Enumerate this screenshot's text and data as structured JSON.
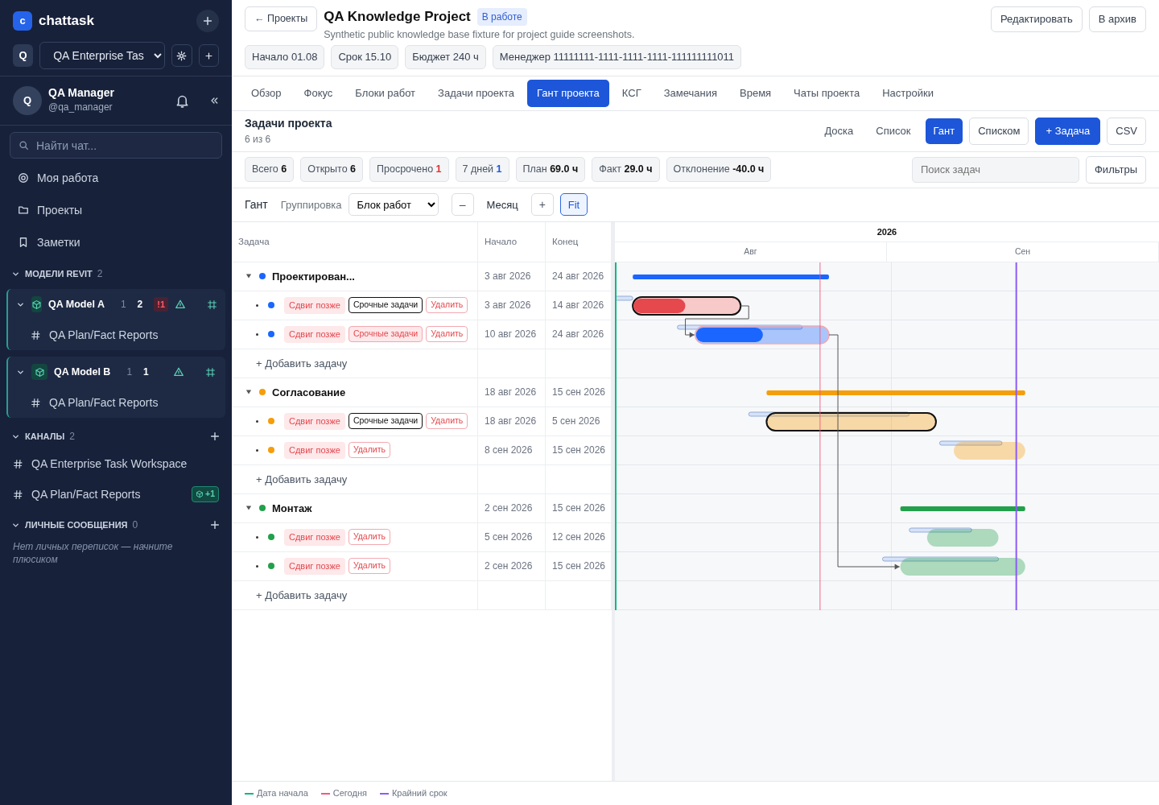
{
  "sidebar": {
    "logo": "c",
    "app_name": "chattask",
    "workspace_avatar": "Q",
    "workspace": "QA Enterprise Tas",
    "user": {
      "avatar": "Q",
      "name": "QA Manager",
      "handle": "@qa_manager"
    },
    "search": {
      "placeholder": "Найти чат..."
    },
    "nav": [
      {
        "label": "Моя работа",
        "kind": "target"
      },
      {
        "label": "Проекты",
        "kind": "folder"
      },
      {
        "label": "Заметки",
        "kind": "bookmark"
      }
    ],
    "models_section": {
      "title": "МОДЕЛИ REVIT",
      "count": "2",
      "expanded": true,
      "models": [
        {
          "name": "QA Model A",
          "expanded": true,
          "counts": [
            "1",
            "2"
          ],
          "alert": "!1",
          "channels": [
            "QA Plan/Fact Reports"
          ]
        },
        {
          "name": "QA Model B",
          "expanded": true,
          "counts": [
            "1",
            "1"
          ],
          "channels": [
            "QA Plan/Fact Reports"
          ]
        }
      ]
    },
    "channels_section": {
      "title": "КАНАЛЫ",
      "count": "2",
      "expanded": true,
      "channels": [
        {
          "name": "QA Enterprise Task Workspace"
        },
        {
          "name": "QA Plan/Fact Reports",
          "badge": "+1"
        }
      ]
    },
    "dm_section": {
      "title": "ЛИЧНЫЕ СООБЩЕНИЯ",
      "count": "0",
      "expanded": true,
      "empty_text": "Нет личных переписок — начните плюсиком"
    }
  },
  "header": {
    "back": "← Проекты",
    "title": "QA Knowledge Project",
    "status": "В работе",
    "description": "Synthetic public knowledge base fixture for project guide screenshots.",
    "chips": [
      "Начало 01.08",
      "Срок 15.10",
      "Бюджет 240 ч",
      "Менеджер 11111111-1111-1111-1111-111111111011"
    ],
    "actions": [
      "Редактировать",
      "В архив"
    ]
  },
  "tabs": [
    {
      "label": "Обзор",
      "selected": false
    },
    {
      "label": "Фокус",
      "selected": false
    },
    {
      "label": "Блоки работ",
      "selected": false
    },
    {
      "label": "Задачи проекта",
      "selected": false
    },
    {
      "label": "Гант проекта",
      "selected": true
    },
    {
      "label": "КСГ",
      "selected": false
    },
    {
      "label": "Замечания",
      "selected": false
    },
    {
      "label": "Время",
      "selected": false
    },
    {
      "label": "Чаты проекта",
      "selected": false
    },
    {
      "label": "Настройки",
      "selected": false
    }
  ],
  "tasks": {
    "title": "Задачи проекта",
    "count": "6 из 6",
    "views": [
      {
        "label": "Доска",
        "selected": false
      },
      {
        "label": "Список",
        "selected": false
      },
      {
        "label": "Гант",
        "selected": true
      }
    ],
    "buttons": [
      {
        "label": "Списком",
        "kind": "outline"
      },
      {
        "label": "+ Задача",
        "kind": "primary"
      },
      {
        "label": "CSV",
        "kind": "outline"
      }
    ],
    "stats": [
      {
        "label": "Всего",
        "value": "6",
        "kind": "plain"
      },
      {
        "label": "Открыто",
        "value": "6",
        "kind": "plain"
      },
      {
        "label": "Просрочено",
        "value": "1",
        "kind": "danger"
      },
      {
        "label": "7 дней",
        "value": "1",
        "kind": "primary"
      },
      {
        "label": "План",
        "value": "69.0 ч",
        "kind": "plain"
      },
      {
        "label": "Факт",
        "value": "29.0 ч",
        "kind": "plain"
      },
      {
        "label": "Отклонение",
        "value": "-40.0 ч",
        "kind": "plain"
      }
    ],
    "search": {
      "placeholder": "Поиск задач"
    },
    "filters": "Фильтры"
  },
  "gantt": {
    "label": "Гант",
    "grouping_label": "Группировка",
    "grouping": "Блок работ",
    "zoom_out": "–",
    "scale": "Месяц",
    "zoom_in": "+",
    "fit": {
      "label": "Fit",
      "selected": true
    },
    "columns": [
      "Задача",
      "Начало",
      "Конец"
    ],
    "year": "2026",
    "months": [
      "Авг",
      "Сен"
    ],
    "groups": [
      {
        "name": "Проектирован...",
        "color": "#1a66ff",
        "start": "3 авг 2026",
        "end": "24 авг 2026",
        "expanded": true,
        "add": "+ Добавить задачу",
        "tasks": [
          {
            "tag": "Сдвиг позже",
            "start": "3 авг 2026",
            "end": "14 авг 2026",
            "overdue": true,
            "level": 0.48,
            "actions": [
              {
                "label": "Срочные задачи",
                "kind": "urgent",
                "selected": true
              },
              {
                "label": "Удалить",
                "kind": "delete"
              }
            ]
          },
          {
            "tag": "Сдвиг позже",
            "start": "10 авг 2026",
            "end": "24 авг 2026",
            "overdue": false,
            "level": 0.5,
            "actions": [
              {
                "label": "Срочные задачи",
                "kind": "urgent",
                "selected": false
              },
              {
                "label": "Удалить",
                "kind": "delete"
              }
            ]
          }
        ]
      },
      {
        "name": "Согласование",
        "color": "#f59e0b",
        "start": "18 авг 2026",
        "end": "15 сен 2026",
        "expanded": true,
        "add": "+ Добавить задачу",
        "tasks": [
          {
            "tag": "Сдвиг позже",
            "start": "18 авг 2026",
            "end": "5 сен 2026",
            "overdue": false,
            "actions": [
              {
                "label": "Срочные задачи",
                "kind": "urgent",
                "selected": true
              },
              {
                "label": "Удалить",
                "kind": "delete"
              }
            ]
          },
          {
            "tag": "Сдвиг позже",
            "start": "8 сен 2026",
            "end": "15 сен 2026",
            "overdue": false,
            "actions": [
              {
                "label": "Удалить",
                "kind": "delete"
              }
            ]
          }
        ]
      },
      {
        "name": "Монтаж",
        "color": "#22a04b",
        "start": "2 сен 2026",
        "end": "15 сен 2026",
        "expanded": true,
        "add": "+ Добавить задачу",
        "tasks": [
          {
            "tag": "Сдвиг позже",
            "start": "5 сен 2026",
            "end": "12 сен 2026",
            "overdue": false,
            "actions": [
              {
                "label": "Удалить",
                "kind": "delete"
              }
            ]
          },
          {
            "tag": "Сдвиг позже",
            "start": "2 сен 2026",
            "end": "15 сен 2026",
            "overdue": false,
            "actions": [
              {
                "label": "Удалить",
                "kind": "delete"
              }
            ]
          }
        ]
      }
    ],
    "legend": [
      {
        "label": "Дата начала",
        "color": "#10b981"
      },
      {
        "label": "Сегодня",
        "color": "#f05a7e"
      },
      {
        "label": "Крайний срок",
        "color": "#8b5cf6"
      }
    ]
  }
}
